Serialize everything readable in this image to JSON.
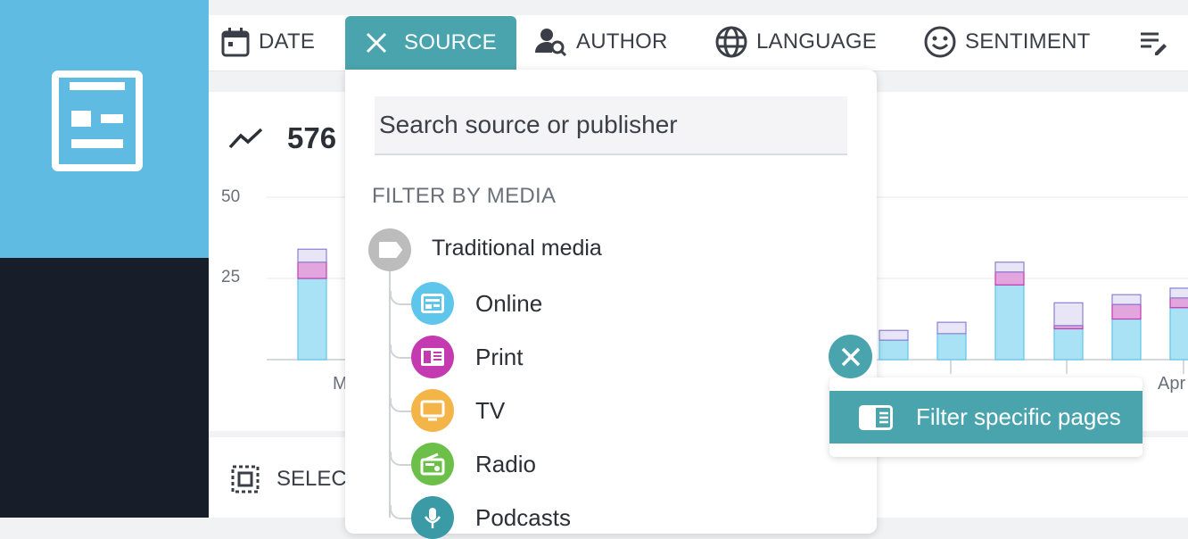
{
  "toolbar": {
    "filters": [
      {
        "id": "date",
        "label": "DATE",
        "icon": "calendar-icon"
      },
      {
        "id": "source",
        "label": "SOURCE",
        "icon": "close-icon",
        "active": true
      },
      {
        "id": "author",
        "label": "AUTHOR",
        "icon": "author-search-icon"
      },
      {
        "id": "language",
        "label": "LANGUAGE",
        "icon": "globe-icon"
      },
      {
        "id": "sentiment",
        "label": "SENTIMENT",
        "icon": "smiley-icon"
      },
      {
        "id": "more",
        "label": "",
        "icon": "edit-list-icon"
      }
    ]
  },
  "summary": {
    "count": "576"
  },
  "chart_data": {
    "type": "bar",
    "stacked": true,
    "ylim": [
      0,
      50
    ],
    "y_ticks": [
      "50",
      "25"
    ],
    "x_tick_labels": [
      "M",
      "Apr"
    ],
    "categories": [
      "b1",
      "b2",
      "b3",
      "b4",
      "b5",
      "b6",
      "b7",
      "b8"
    ],
    "series": [
      {
        "color": "#a9e2f5",
        "values": [
          25,
          6,
          8,
          23,
          9.5,
          12.5,
          16,
          23
        ]
      },
      {
        "color": "#e2a5dd",
        "values": [
          5,
          0,
          0,
          4,
          1,
          4.5,
          3,
          0
        ]
      },
      {
        "color": "#e8e5f7",
        "values": [
          4,
          3,
          3.5,
          3,
          7,
          3,
          3,
          3
        ]
      }
    ]
  },
  "select": {
    "label": "SELEC"
  },
  "dropdown": {
    "search_placeholder": "Search source or publisher",
    "section_title": "FILTER BY MEDIA",
    "root": {
      "label": "Traditional media",
      "icon": "tag-icon"
    },
    "items": [
      {
        "label": "Online",
        "icon": "online-icon",
        "color": "#5ec6ea"
      },
      {
        "label": "Print",
        "icon": "print-icon",
        "color": "#c43ab1"
      },
      {
        "label": "TV",
        "icon": "tv-icon",
        "color": "#f3b548"
      },
      {
        "label": "Radio",
        "icon": "radio-icon",
        "color": "#6cc04a"
      },
      {
        "label": "Podcasts",
        "icon": "microphone-icon",
        "color": "#3a9aa6"
      }
    ]
  },
  "page_filter": {
    "label": "Filter specific pages",
    "icon": "page-icon"
  },
  "colors": {
    "accent": "#4aa4ae",
    "sidebar": "#5fbbe2",
    "sidebar_dark": "#181d2a"
  }
}
